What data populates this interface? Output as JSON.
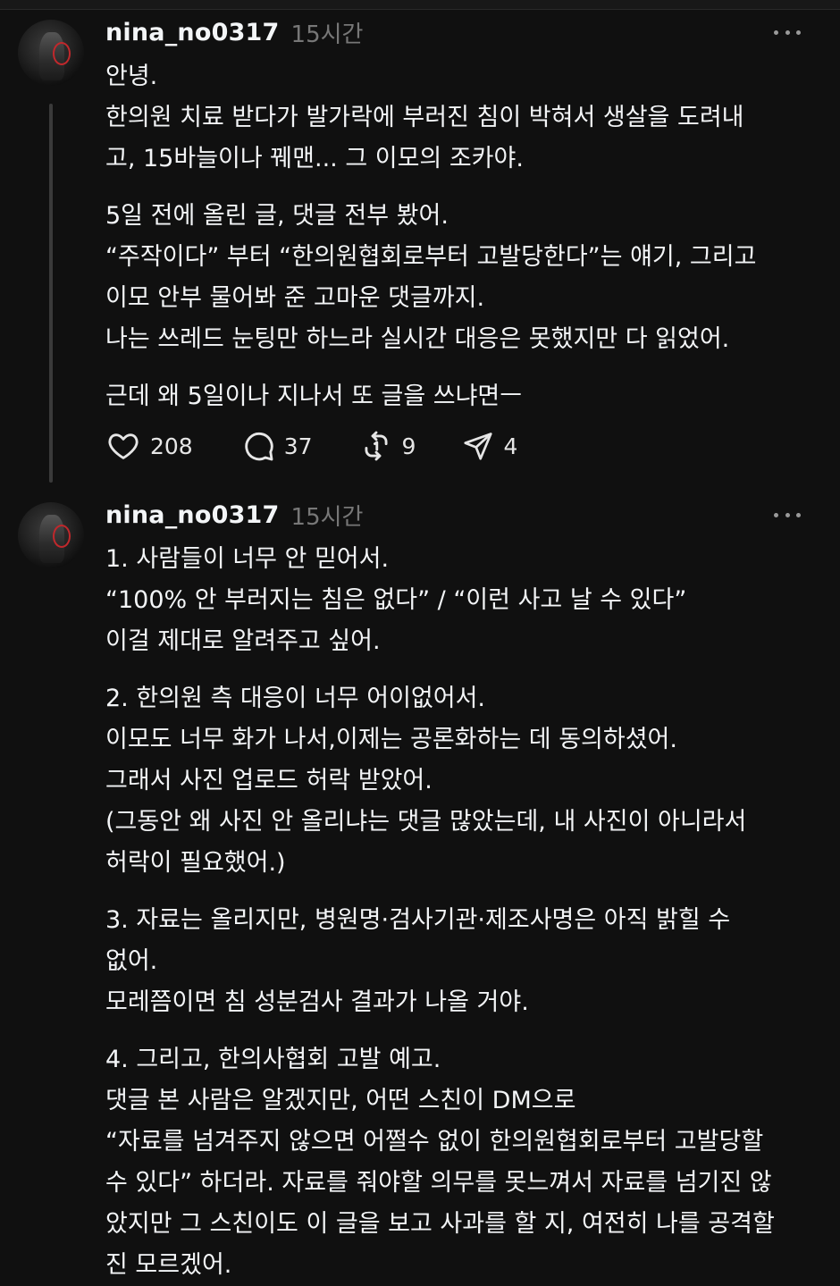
{
  "posts": [
    {
      "username": "nina_no0317",
      "time": "15시간",
      "paragraphs": [
        [
          "안녕.",
          "한의원 치료 받다가 발가락에 부러진 침이 박혀서 생살을 도려내",
          "고, 15바늘이나 꿰맨... 그 이모의 조카야."
        ],
        [
          "5일 전에 올린 글, 댓글 전부 봤어.",
          "“주작이다” 부터 “한의원협회로부터 고발당한다”는 얘기, 그리고",
          "이모 안부 물어봐 준 고마운 댓글까지.",
          "나는 쓰레드 눈팅만 하느라 실시간 대응은 못했지만 다 읽었어."
        ],
        [
          "근데 왜 5일이나 지나서 또 글을 쓰냐면ㅡ"
        ]
      ],
      "actions": {
        "likes": "208",
        "comments": "37",
        "reposts": "9",
        "shares": "4"
      }
    },
    {
      "username": "nina_no0317",
      "time": "15시간",
      "paragraphs": [
        [
          "1. 사람들이 너무 안 믿어서.",
          "“100% 안 부러지는 침은 없다” / “이런 사고 날 수 있다”",
          "이걸 제대로 알려주고 싶어."
        ],
        [
          "2. 한의원 측 대응이 너무 어이없어서.",
          "이모도 너무 화가 나서,이제는 공론화하는 데 동의하셨어.",
          "그래서 사진 업로드 허락 받았어.",
          "(그동안 왜 사진 안 올리냐는 댓글 많았는데, 내 사진이 아니라서",
          "허락이 필요했어.)"
        ],
        [
          "3. 자료는 올리지만, 병원명·검사기관·제조사명은 아직 밝힐 수",
          "없어.",
          "모레쯤이면 침 성분검사 결과가 나올 거야."
        ],
        [
          "4. 그리고, 한의사협회 고발 예고.",
          "댓글 본 사람은 알겠지만, 어떤 스친이 DM으로",
          "“자료를 넘겨주지 않으면 어쩔수 없이 한의원협회로부터 고발당할",
          "수 있다” 하더라. 자료를 줘야할 의무를 못느껴서 자료를 넘기진 않",
          "았지만 그 스친이도 이 글을 보고 사과를 할 지, 여전히 나를 공격할",
          "진 모르겠어."
        ]
      ]
    }
  ]
}
